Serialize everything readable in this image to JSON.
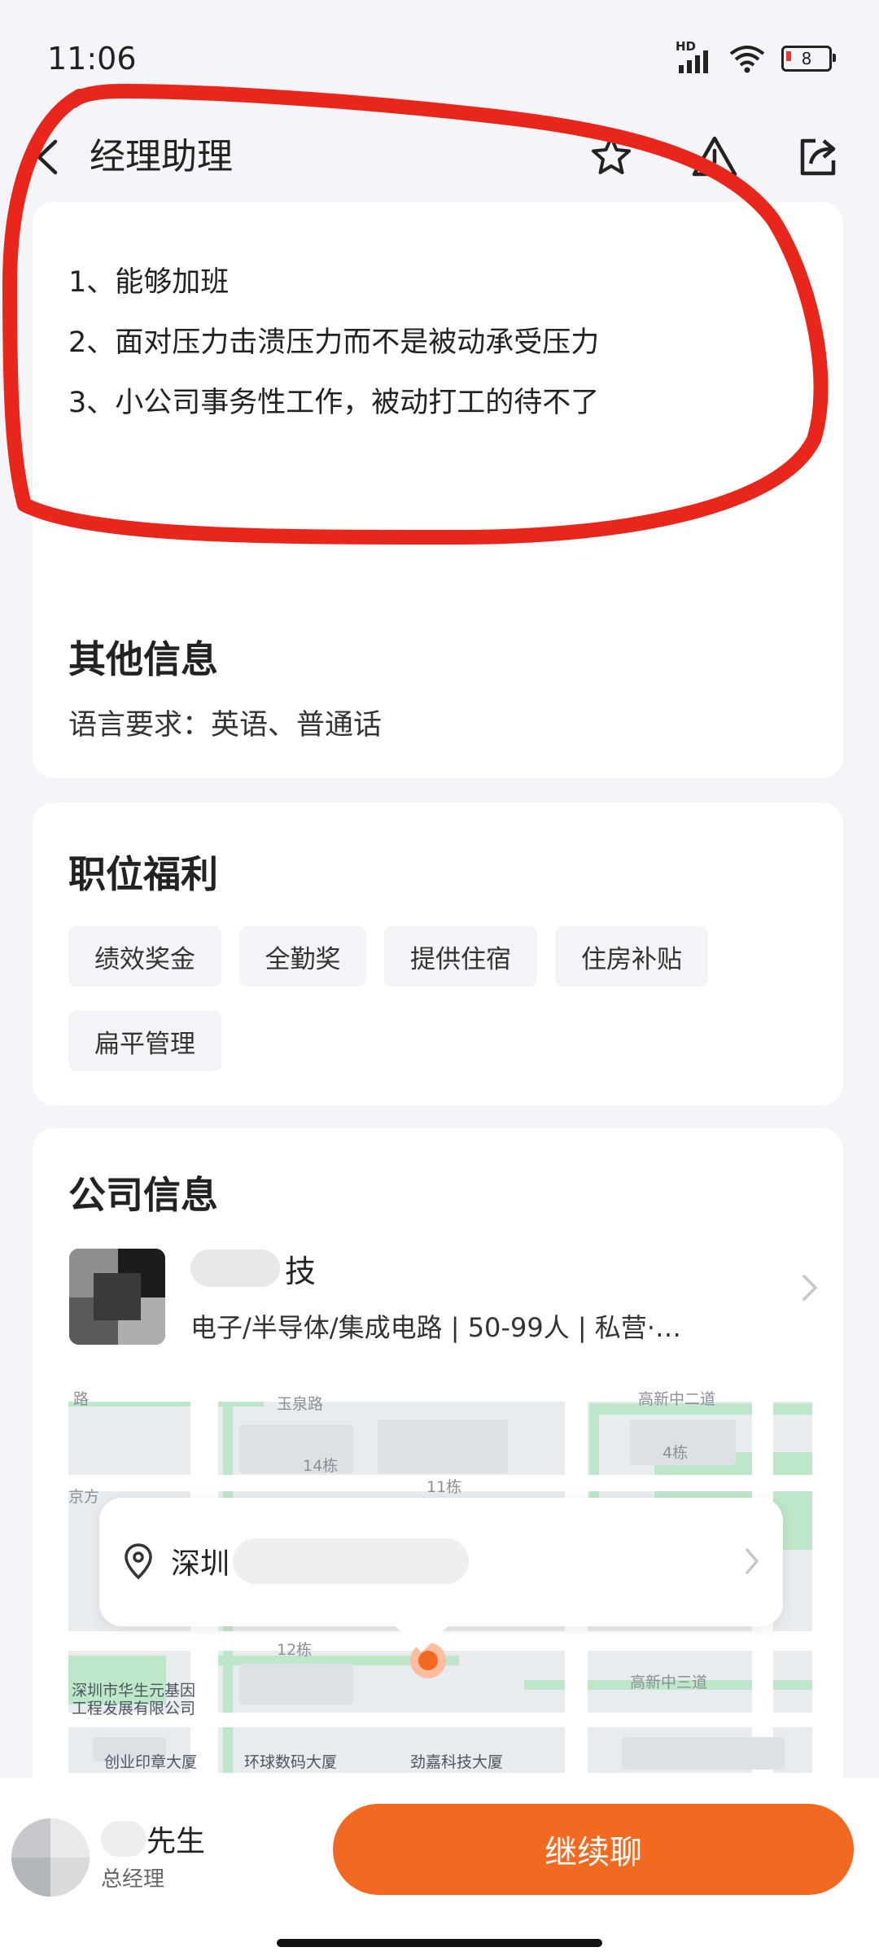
{
  "status_bar": {
    "time": "11:06",
    "signal_label": "HD",
    "battery": "8"
  },
  "header": {
    "title": "经理助理"
  },
  "job_description": {
    "lines": [
      "1、能够加班",
      "2、面对压力击溃压力而不是被动承受压力",
      "3、小公司事务性工作，被动打工的待不了"
    ]
  },
  "other_info": {
    "title": "其他信息",
    "language": "语言要求：英语、普通话"
  },
  "benefits": {
    "title": "职位福利",
    "tags": [
      "绩效奖金",
      "全勤奖",
      "提供住宿",
      "住房补贴",
      "扁平管理"
    ]
  },
  "company": {
    "title": "公司信息",
    "name_visible": "技",
    "meta": "电子/半导体/集成电路 | 50-99人 | 私营·…",
    "address_visible": "深圳"
  },
  "map": {
    "labels": [
      "路",
      "玉泉路",
      "高新中二道",
      "14栋",
      "4栋",
      "11栋",
      "京方",
      "12栋",
      "高新中三道"
    ],
    "pois": [
      "深圳市华生元基因工程发展有限公司",
      "创业印章大厦",
      "环球数码大厦",
      "劲嘉科技大厦"
    ]
  },
  "recruiter": {
    "name_visible": "先生",
    "role": "总经理"
  },
  "actions": {
    "chat": "继续聊"
  },
  "colors": {
    "accent": "#f26a21",
    "annotation": "#e8261c"
  }
}
